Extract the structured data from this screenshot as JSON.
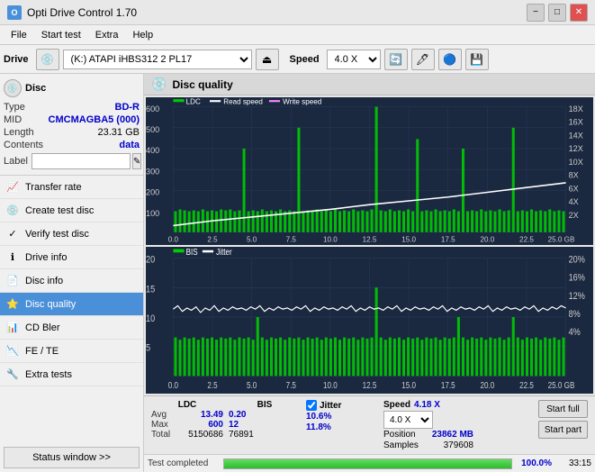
{
  "titlebar": {
    "icon": "O",
    "title": "Opti Drive Control 1.70",
    "minimize": "−",
    "maximize": "□",
    "close": "✕"
  },
  "menubar": {
    "items": [
      "File",
      "Start test",
      "Extra",
      "Help"
    ]
  },
  "toolbar": {
    "drive_label": "Drive",
    "drive_value": "(K:)  ATAPI iHBS312  2 PL17",
    "speed_label": "Speed",
    "speed_value": "4.0 X"
  },
  "disc": {
    "type_label": "Type",
    "type_value": "BD-R",
    "mid_label": "MID",
    "mid_value": "CMCMAGBA5 (000)",
    "length_label": "Length",
    "length_value": "23.31 GB",
    "contents_label": "Contents",
    "contents_value": "data",
    "label_label": "Label",
    "label_placeholder": ""
  },
  "nav": {
    "items": [
      {
        "id": "transfer-rate",
        "label": "Transfer rate",
        "icon": "📈"
      },
      {
        "id": "create-test-disc",
        "label": "Create test disc",
        "icon": "💿"
      },
      {
        "id": "verify-test-disc",
        "label": "Verify test disc",
        "icon": "✅"
      },
      {
        "id": "drive-info",
        "label": "Drive info",
        "icon": "ℹ"
      },
      {
        "id": "disc-info",
        "label": "Disc info",
        "icon": "📄"
      },
      {
        "id": "disc-quality",
        "label": "Disc quality",
        "icon": "⭐",
        "active": true
      },
      {
        "id": "cd-bler",
        "label": "CD Bler",
        "icon": "📊"
      },
      {
        "id": "fe-te",
        "label": "FE / TE",
        "icon": "📉"
      },
      {
        "id": "extra-tests",
        "label": "Extra tests",
        "icon": "🔧"
      }
    ]
  },
  "status_window": "Status window >>",
  "chart": {
    "title": "Disc quality",
    "legend_top": [
      "LDC",
      "Read speed",
      "Write speed"
    ],
    "legend_bottom": [
      "BIS",
      "Jitter"
    ],
    "y_labels_top": [
      "600",
      "500",
      "400",
      "300",
      "200",
      "100"
    ],
    "y_labels_right_top": [
      "18X",
      "16X",
      "14X",
      "12X",
      "10X",
      "8X",
      "6X",
      "4X",
      "2X"
    ],
    "x_labels": [
      "0.0",
      "2.5",
      "5.0",
      "7.5",
      "10.0",
      "12.5",
      "15.0",
      "17.5",
      "20.0",
      "22.5",
      "25.0 GB"
    ],
    "y_labels_bottom": [
      "20",
      "15",
      "10",
      "5"
    ],
    "y_labels_right_bottom": [
      "20%",
      "16%",
      "12%",
      "8%",
      "4%"
    ]
  },
  "stats": {
    "ldc_header": "LDC",
    "bis_header": "BIS",
    "jitter_header": "Jitter",
    "speed_header": "Speed",
    "position_header": "Position",
    "samples_header": "Samples",
    "avg_label": "Avg",
    "max_label": "Max",
    "total_label": "Total",
    "ldc_avg": "13.49",
    "ldc_max": "600",
    "ldc_total": "5150686",
    "bis_avg": "0.20",
    "bis_max": "12",
    "bis_total": "76891",
    "jitter_avg": "10.6%",
    "jitter_max": "11.8%",
    "speed_val": "4.18 X",
    "speed_select": "4.0 X",
    "position_val": "23862 MB",
    "samples_val": "379608",
    "start_full": "Start full",
    "start_part": "Start part"
  },
  "progress": {
    "status": "Test completed",
    "percent": "100.0%",
    "time": "33:15"
  }
}
